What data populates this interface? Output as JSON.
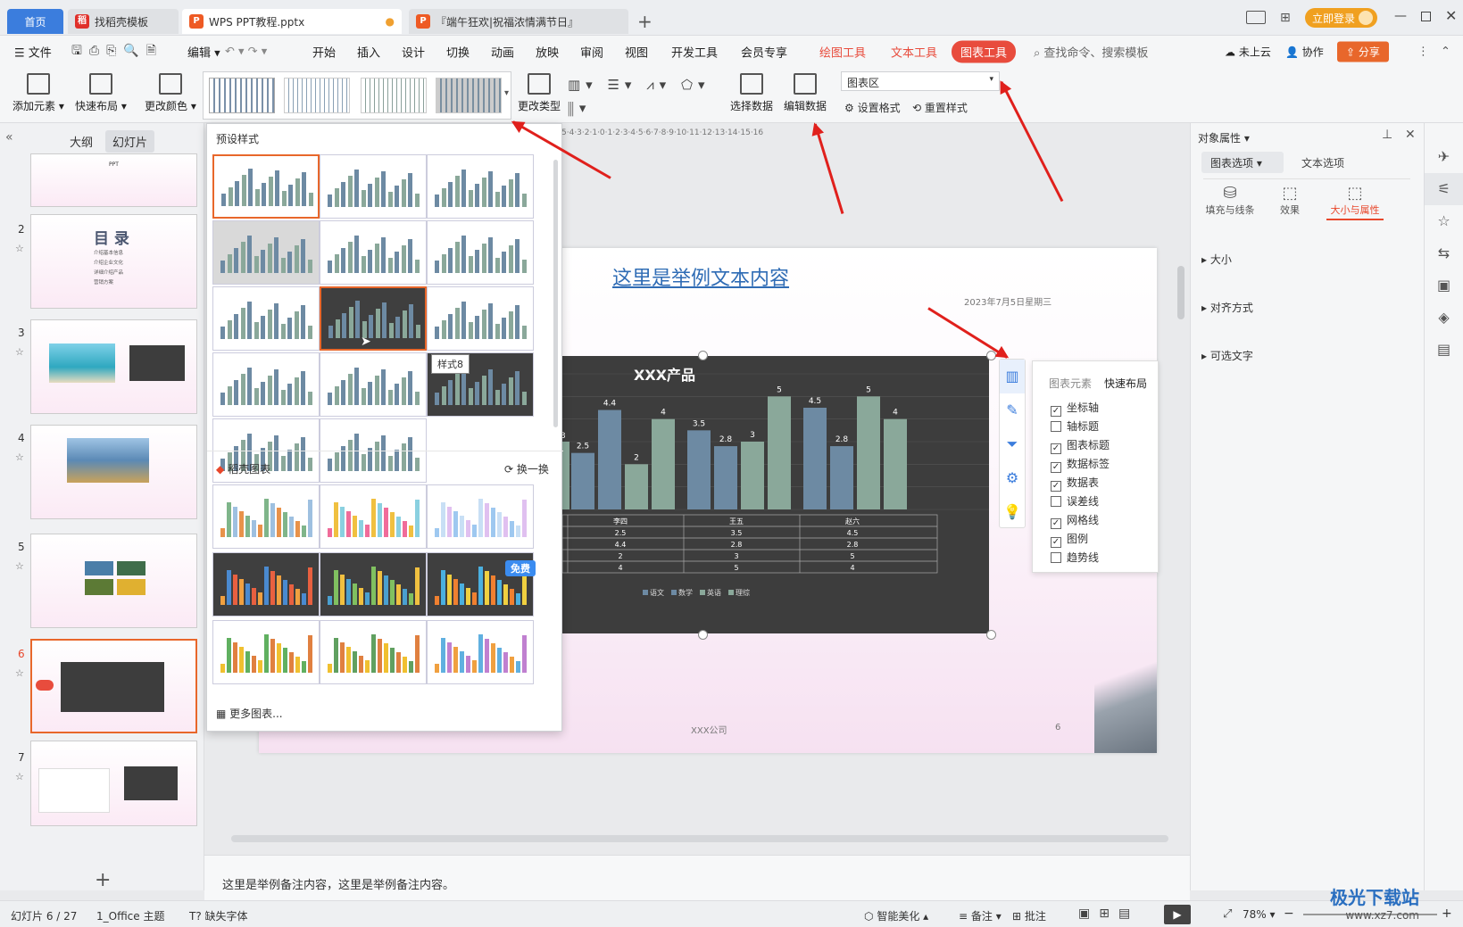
{
  "tabs": {
    "home": "首页",
    "template": "找稻壳模板",
    "doc": "WPS PPT教程.pptx",
    "other": "『端午狂欢|祝福浓情满节日』",
    "login": "立即登录"
  },
  "menu": {
    "file": "文件",
    "edit": "编辑",
    "items": [
      "开始",
      "插入",
      "设计",
      "切换",
      "动画",
      "放映",
      "审阅",
      "视图",
      "开发工具",
      "会员专享"
    ],
    "draw_tool": "绘图工具",
    "text_tool": "文本工具",
    "chart_tool": "图表工具",
    "search": "查找命令、搜索模板",
    "cloud": "未上云",
    "collab": "协作",
    "share": "分享"
  },
  "ribbon": {
    "add_element": "添加元素",
    "quick_layout": "快速布局",
    "change_color": "更改颜色",
    "change_type": "更改类型",
    "select_data": "选择数据",
    "edit_data": "编辑数据",
    "chart_area": "图表区",
    "set_format": "设置格式",
    "reset_style": "重置样式"
  },
  "left": {
    "outline": "大纲",
    "slides": "幻灯片",
    "slide_nums": [
      "2",
      "3",
      "4",
      "5",
      "6",
      "7"
    ],
    "toc_title": "目 录",
    "toc_items": [
      "介绍基本信息",
      "介绍企业文化",
      "详细介绍产品",
      "营销方案"
    ],
    "thumb1_text": "PPT"
  },
  "dropdown": {
    "preset": "预设样式",
    "tooltip": "样式8",
    "daoke": "稻壳图表",
    "refresh": "换一换",
    "free": "免费",
    "more": "更多图表..."
  },
  "slide": {
    "heading": "这里是举例文本内容",
    "date": "2023年7月5日星期三",
    "company": "XXX公司",
    "page": "6"
  },
  "chart_data": {
    "type": "bar",
    "title": "XXX产品",
    "categories": [
      "李四",
      "王五",
      "赵六"
    ],
    "series": [
      {
        "name": "语文",
        "values": [
          2.5,
          3.5,
          4.5
        ]
      },
      {
        "name": "数学",
        "values": [
          4.4,
          2.8,
          2.8
        ]
      },
      {
        "name": "英语",
        "values": [
          2,
          3,
          5
        ]
      },
      {
        "name": "理综",
        "values": [
          4,
          5,
          4
        ]
      }
    ],
    "partial_labels": [
      "3"
    ],
    "ylim": [
      0,
      6
    ],
    "grid": true,
    "legend": "bottom",
    "bar_colors": [
      "#6d8aa3",
      "#6d8aa3",
      "#8aa89a",
      "#8aa89a"
    ]
  },
  "chart_popup": {
    "tab1": "图表元素",
    "tab2": "快速布局",
    "items": [
      {
        "label": "坐标轴",
        "checked": true
      },
      {
        "label": "轴标题",
        "checked": false
      },
      {
        "label": "图表标题",
        "checked": true
      },
      {
        "label": "数据标签",
        "checked": true
      },
      {
        "label": "数据表",
        "checked": true
      },
      {
        "label": "误差线",
        "checked": false
      },
      {
        "label": "网格线",
        "checked": true
      },
      {
        "label": "图例",
        "checked": true
      },
      {
        "label": "趋势线",
        "checked": false
      }
    ]
  },
  "right": {
    "title": "对象属性",
    "tab_chart": "图表选项",
    "tab_text": "文本选项",
    "fill": "填充与线条",
    "effect": "效果",
    "size_prop": "大小与属性",
    "sec1": "大小",
    "sec2": "对齐方式",
    "sec3": "可选文字"
  },
  "notes": "这里是举例备注内容，这里是举例备注内容。",
  "status": {
    "slide": "幻灯片 6 / 27",
    "theme": "1_Office 主题",
    "font": "缺失字体",
    "beautify": "智能美化",
    "notes": "备注",
    "comment": "批注",
    "zoom": "78%"
  },
  "ruler": "5·4·3·2·1·0·1·2·3·4·5·6·7·8·9·10·11·12·13·14·15·16",
  "colors": {
    "accent": "#e8472b",
    "chart_bg": "#3d3d3d",
    "tool_red": "#e84c3d"
  },
  "watermark": {
    "site": "极光下载站",
    "url": "www.xz7.com"
  }
}
